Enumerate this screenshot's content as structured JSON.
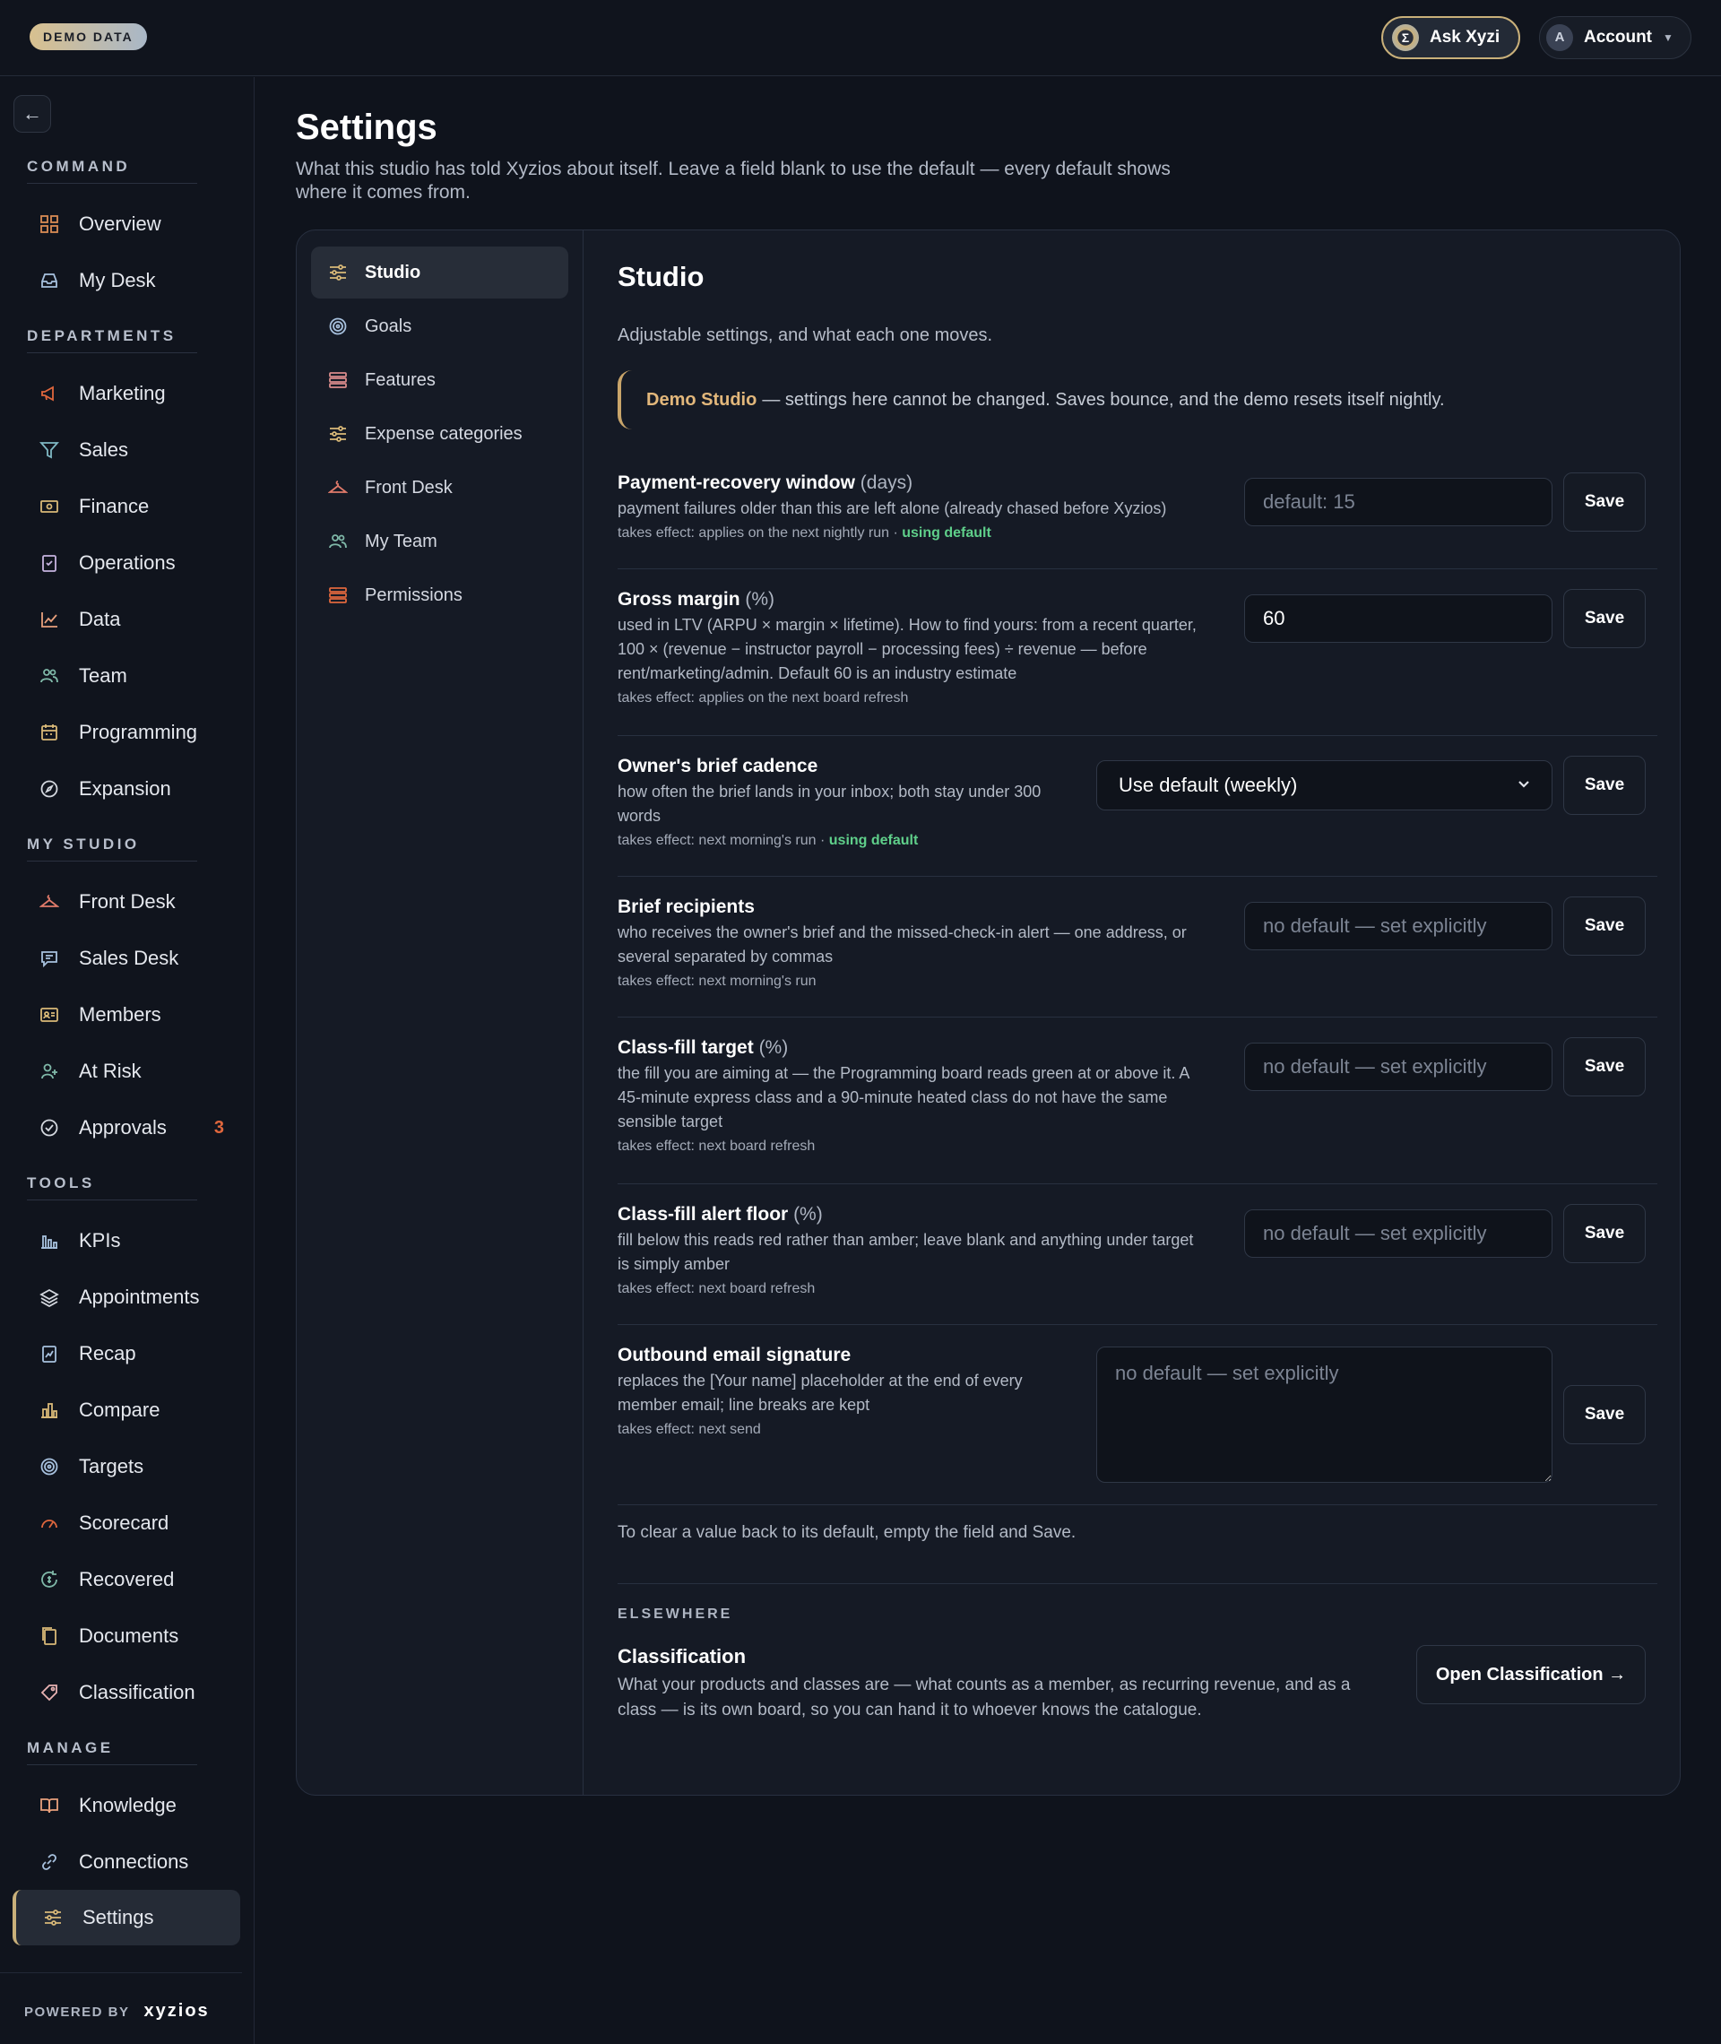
{
  "topbar": {
    "badge": "DEMO DATA",
    "ask_label": "Ask Xyzi",
    "account_label": "Account",
    "account_initial": "A"
  },
  "sidebar": {
    "sections": [
      {
        "label": "COMMAND",
        "items": [
          {
            "label": "Overview",
            "icon": "grid-icon"
          },
          {
            "label": "My Desk",
            "icon": "inbox-icon"
          }
        ]
      },
      {
        "label": "DEPARTMENTS",
        "items": [
          {
            "label": "Marketing",
            "icon": "megaphone-icon"
          },
          {
            "label": "Sales",
            "icon": "funnel-icon"
          },
          {
            "label": "Finance",
            "icon": "banknote-icon"
          },
          {
            "label": "Operations",
            "icon": "clipboard-icon"
          },
          {
            "label": "Data",
            "icon": "line-chart-icon"
          },
          {
            "label": "Team",
            "icon": "users-icon"
          },
          {
            "label": "Programming",
            "icon": "calendar-icon"
          },
          {
            "label": "Expansion",
            "icon": "compass-icon"
          }
        ]
      },
      {
        "label": "MY STUDIO",
        "items": [
          {
            "label": "Front Desk",
            "icon": "hanger-icon"
          },
          {
            "label": "Sales Desk",
            "icon": "chat-icon"
          },
          {
            "label": "Members",
            "icon": "id-card-icon"
          },
          {
            "label": "At Risk",
            "icon": "user-plus-icon"
          },
          {
            "label": "Approvals",
            "icon": "check-circle-icon",
            "badge": "3"
          }
        ]
      },
      {
        "label": "TOOLS",
        "items": [
          {
            "label": "KPIs",
            "icon": "bar-chart-icon"
          },
          {
            "label": "Appointments",
            "icon": "layers-icon"
          },
          {
            "label": "Recap",
            "icon": "recap-icon"
          },
          {
            "label": "Compare",
            "icon": "compare-icon"
          },
          {
            "label": "Targets",
            "icon": "target-icon"
          },
          {
            "label": "Scorecard",
            "icon": "gauge-icon"
          },
          {
            "label": "Recovered",
            "icon": "recovered-icon"
          },
          {
            "label": "Documents",
            "icon": "documents-icon"
          },
          {
            "label": "Classification",
            "icon": "tag-icon"
          }
        ]
      },
      {
        "label": "MANAGE",
        "items": [
          {
            "label": "Knowledge",
            "icon": "book-icon"
          },
          {
            "label": "Connections",
            "icon": "link-icon"
          },
          {
            "label": "Settings",
            "icon": "sliders-icon",
            "active": true
          }
        ]
      }
    ],
    "powered_by": "POWERED BY",
    "brand": "xyzios"
  },
  "page": {
    "title": "Settings",
    "subtitle": "What this studio has told Xyzios about itself. Leave a field blank to use the default — every default shows where it comes from."
  },
  "subnav": [
    {
      "label": "Studio",
      "icon": "sliders-icon",
      "active": true
    },
    {
      "label": "Goals",
      "icon": "target-icon"
    },
    {
      "label": "Features",
      "icon": "stack-icon"
    },
    {
      "label": "Expense categories",
      "icon": "sliders-icon"
    },
    {
      "label": "Front Desk",
      "icon": "hanger-icon"
    },
    {
      "label": "My Team",
      "icon": "users-icon"
    },
    {
      "label": "Permissions",
      "icon": "stack-icon"
    }
  ],
  "content": {
    "title": "Studio",
    "subtitle": "Adjustable settings, and what each one moves.",
    "notice_highlight": "Demo Studio",
    "notice_text": "— settings here cannot be changed. Saves bounce, and the demo resets itself nightly.",
    "save_label": "Save",
    "settings": [
      {
        "name": "Payment-recovery window",
        "unit": "(days)",
        "desc": "payment failures older than this are left alone (already chased before Xyzios)",
        "effect": "takes effect: applies on the next nightly run ·",
        "default_flag": "using default",
        "placeholder": "default: 15",
        "value": ""
      },
      {
        "name": "Gross margin",
        "unit": "(%)",
        "desc": "used in LTV (ARPU × margin × lifetime). How to find yours: from a recent quarter, 100 × (revenue − instructor payroll − processing fees) ÷ revenue — before rent/marketing/admin. Default 60 is an industry estimate",
        "effect": "takes effect: applies on the next board refresh",
        "default_flag": "",
        "placeholder": "",
        "value": "60"
      },
      {
        "name": "Owner's brief cadence",
        "unit": "",
        "desc": "how often the brief lands in your inbox; both stay under 300 words",
        "effect": "takes effect: next morning's run ·",
        "default_flag": "using default",
        "selected": "Use default (weekly)"
      },
      {
        "name": "Brief recipients",
        "unit": "",
        "desc": "who receives the owner's brief and the missed-check-in alert — one address, or several separated by commas",
        "effect": "takes effect: next morning's run",
        "default_flag": "",
        "placeholder": "no default — set explicitly",
        "value": ""
      },
      {
        "name": "Class-fill target",
        "unit": "(%)",
        "desc": "the fill you are aiming at — the Programming board reads green at or above it. A 45-minute express class and a 90-minute heated class do not have the same sensible target",
        "effect": "takes effect: next board refresh",
        "default_flag": "",
        "placeholder": "no default — set explicitly",
        "value": ""
      },
      {
        "name": "Class-fill alert floor",
        "unit": "(%)",
        "desc": "fill below this reads red rather than amber; leave blank and anything under target is simply amber",
        "effect": "takes effect: next board refresh",
        "default_flag": "",
        "placeholder": "no default — set explicitly",
        "value": ""
      },
      {
        "name": "Outbound email signature",
        "unit": "",
        "desc": "replaces the [Your name] placeholder at the end of every member email; line breaks are kept",
        "effect": "takes effect: next send",
        "default_flag": "",
        "placeholder": "no default — set explicitly",
        "value": ""
      }
    ],
    "clear_note": "To clear a value back to its default, empty the field and Save.",
    "elsewhere_label": "ELSEWHERE",
    "classification_title": "Classification",
    "classification_desc": "What your products and classes are — what counts as a member, as recurring revenue, and as a class — is its own board, so you can hand it to whoever knows the catalogue.",
    "open_label": "Open Classification →"
  },
  "colors": {
    "accent": "#c9b07a",
    "default_green": "#5fcf8a",
    "badge_orange": "#e0673d",
    "background": "#0f131c"
  }
}
